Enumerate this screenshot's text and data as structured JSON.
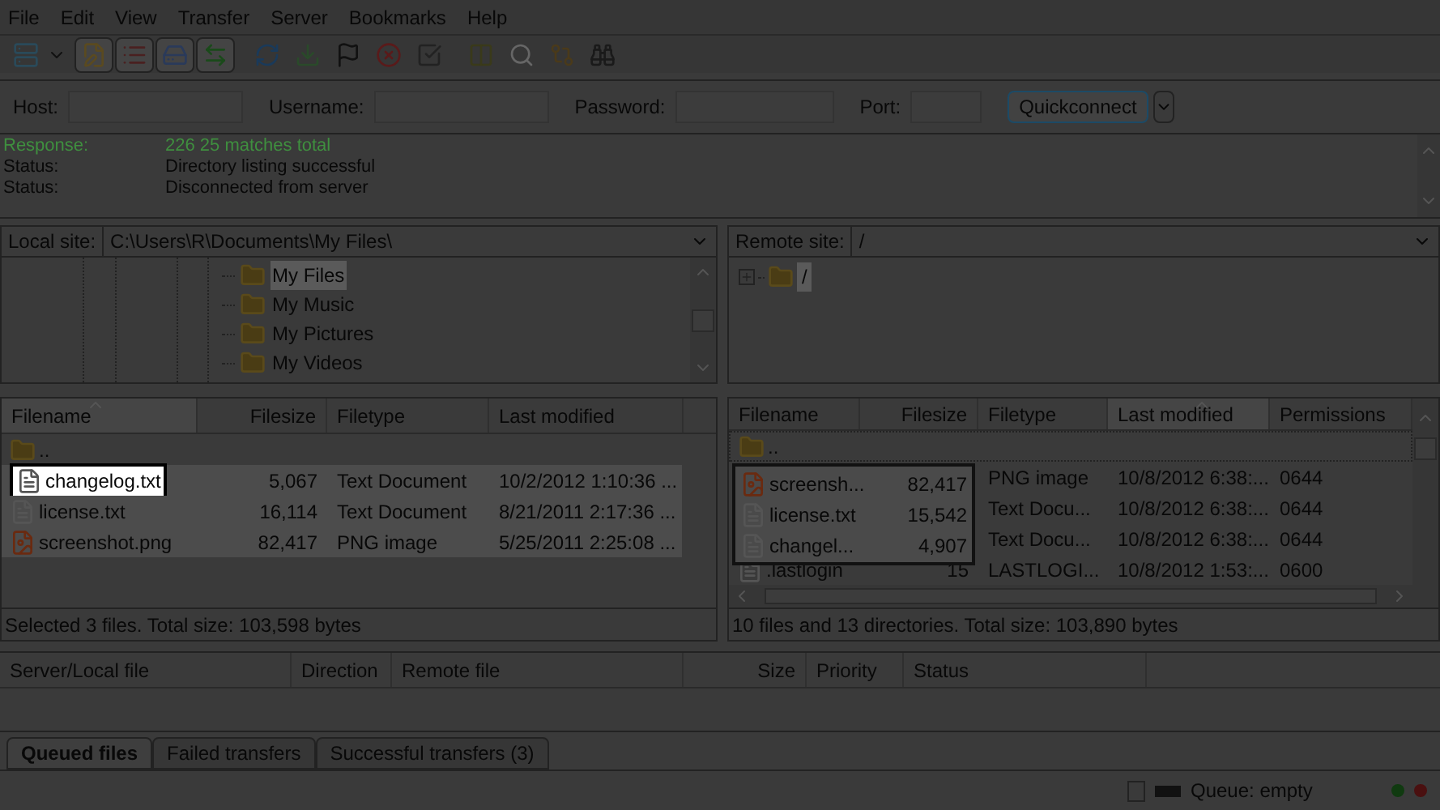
{
  "menu": [
    "File",
    "Edit",
    "View",
    "Transfer",
    "Server",
    "Bookmarks",
    "Help"
  ],
  "quickconnect": {
    "fields": [
      {
        "label": "Host:"
      },
      {
        "label": "Username:"
      },
      {
        "label": "Password:"
      },
      {
        "label": "Port:"
      }
    ],
    "button": "Quickconnect"
  },
  "log": [
    {
      "kind": "response",
      "label": "Response:",
      "text": "226 25 matches total"
    },
    {
      "kind": "status",
      "label": "Status:",
      "text": "Directory listing successful"
    },
    {
      "kind": "status",
      "label": "Status:",
      "text": "Disconnected from server"
    }
  ],
  "local": {
    "site_label": "Local site:",
    "path": "C:\\Users\\R\\Documents\\My Files\\",
    "tree": [
      {
        "name": "My Files",
        "selected": true
      },
      {
        "name": "My Music",
        "selected": false
      },
      {
        "name": "My Pictures",
        "selected": false
      },
      {
        "name": "My Videos",
        "selected": false
      }
    ],
    "columns": [
      {
        "label": "Filename",
        "sorted": true
      },
      {
        "label": "Filesize",
        "sorted": false
      },
      {
        "label": "Filetype",
        "sorted": false
      },
      {
        "label": "Last modified",
        "sorted": false
      }
    ],
    "rows": [
      {
        "kind": "folder",
        "name": "..",
        "selected": false,
        "highlighted": false
      },
      {
        "kind": "text",
        "name": "changelog.txt",
        "size": "5,067",
        "type": "Text Document",
        "modified": "10/2/2012 1:10:36 ...",
        "selected": true,
        "highlighted": true
      },
      {
        "kind": "text",
        "name": "license.txt",
        "size": "16,114",
        "type": "Text Document",
        "modified": "8/21/2011 2:17:36 ...",
        "selected": true,
        "highlighted": false
      },
      {
        "kind": "image",
        "name": "screenshot.png",
        "size": "82,417",
        "type": "PNG image",
        "modified": "5/25/2011 2:25:08 ...",
        "selected": true,
        "highlighted": false
      }
    ],
    "status": "Selected 3 files. Total size: 103,598 bytes"
  },
  "remote": {
    "site_label": "Remote site:",
    "path": "/",
    "tree": [
      {
        "name": "/",
        "selected": true
      }
    ],
    "columns": [
      {
        "label": "Filename",
        "sorted": false
      },
      {
        "label": "Filesize",
        "sorted": false
      },
      {
        "label": "Filetype",
        "sorted": false
      },
      {
        "label": "Last modified",
        "sorted": true
      },
      {
        "label": "Permissions",
        "sorted": false
      }
    ],
    "rows": [
      {
        "kind": "folder",
        "name": "..",
        "type": "",
        "modified": "",
        "permissions": ""
      },
      {
        "kind": "covered",
        "type": "PNG image",
        "modified": "10/8/2012 6:38:...",
        "permissions": "0644"
      },
      {
        "kind": "covered",
        "type": "Text Docu...",
        "modified": "10/8/2012 6:38:...",
        "permissions": "0644"
      },
      {
        "kind": "covered",
        "type": "Text Docu...",
        "modified": "10/8/2012 6:38:...",
        "permissions": "0644"
      },
      {
        "kind": "text",
        "name": ".lastlogin",
        "size": "15",
        "type": "LASTLOGI...",
        "modified": "10/8/2012 1:53:...",
        "permissions": "0600"
      }
    ],
    "drag_preview": [
      {
        "kind": "image",
        "name": "screensh...",
        "size": "82,417"
      },
      {
        "kind": "text",
        "name": "license.txt",
        "size": "15,542"
      },
      {
        "kind": "text",
        "name": "changel...",
        "size": "4,907"
      }
    ],
    "status": "10 files and 13 directories. Total size: 103,890 bytes"
  },
  "queue": {
    "columns": [
      "Server/Local file",
      "Direction",
      "Remote file",
      "Size",
      "Priority",
      "Status"
    ],
    "tabs": [
      {
        "label": "Queued files",
        "selected": true
      },
      {
        "label": "Failed transfers",
        "selected": false
      },
      {
        "label": "Successful transfers (3)",
        "selected": false
      }
    ]
  },
  "status_bar": {
    "queue": "Queue: empty"
  }
}
